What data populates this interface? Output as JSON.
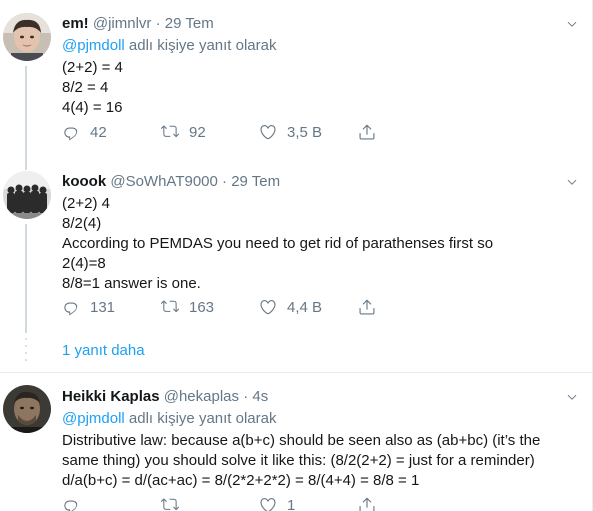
{
  "tweets": [
    {
      "name": "em!",
      "handle": "@jimnlvr",
      "separator": "·",
      "time": "29 Tem",
      "reply_mention": "@pjmdoll",
      "reply_suffix": " adlı kişiye yanıt olarak",
      "lines": [
        "(2+2) = 4",
        "8/2 = 4",
        "4(4) = 16"
      ],
      "replies": "42",
      "retweets": "92",
      "likes": "3,5 B"
    },
    {
      "name": "koook",
      "handle": "@SoWhAT9000",
      "separator": "·",
      "time": "29 Tem",
      "lines": [
        "(2+2) 4",
        "8/2(4)",
        "According to PEMDAS you need to get rid of parathenses first so",
        "2(4)=8",
        "8/8=1 answer is one."
      ],
      "replies": "131",
      "retweets": "163",
      "likes": "4,4 B"
    },
    {
      "name": "Heikki Kaplas",
      "handle": "@hekaplas",
      "separator": "·",
      "time": "4s",
      "reply_mention": "@pjmdoll",
      "reply_suffix": " adlı kişiye yanıt olarak",
      "lines": [
        "Distributive law: because a(b+c) should be seen also as (ab+bc) (it’s the",
        "same thing) you should solve it like this: (8/2(2+2) = just for a reminder)",
        "d/a(b+c) = d/(ac+ac) = 8/(2*2+2*2) = 8/(4+4) = 8/8 = 1"
      ],
      "replies": "",
      "retweets": "",
      "likes": "1"
    }
  ],
  "more_replies_label": "1 yanıt daha",
  "colors": {
    "accent": "#1da1f2",
    "muted": "#657786",
    "text": "#14171a",
    "border": "#e6ecf0"
  },
  "icons": [
    "reply-icon",
    "retweet-icon",
    "like-icon",
    "share-icon",
    "chevron-down-icon"
  ]
}
